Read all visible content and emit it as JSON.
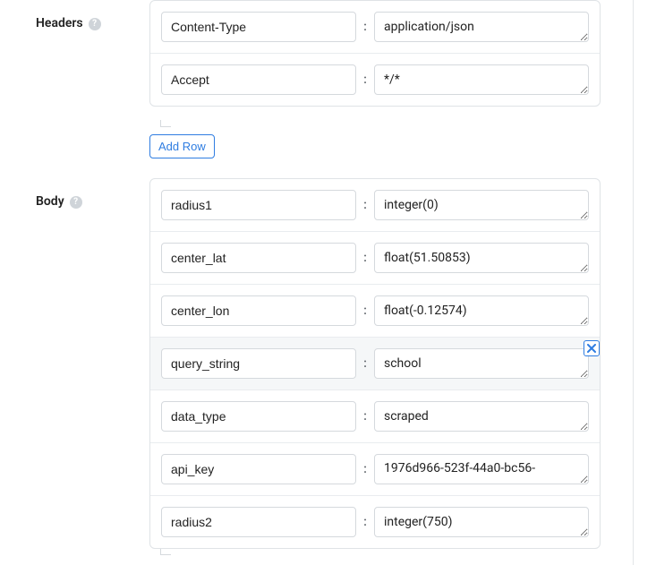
{
  "sections": {
    "headers": {
      "label": "Headers",
      "add_row_label": "Add Row",
      "rows": [
        {
          "key": "Content-Type",
          "value": "application/json"
        },
        {
          "key": "Accept",
          "value": "*/*"
        }
      ]
    },
    "body": {
      "label": "Body",
      "rows": [
        {
          "key": "radius1",
          "value": "integer(0)"
        },
        {
          "key": "center_lat",
          "value": "float(51.50853)"
        },
        {
          "key": "center_lon",
          "value": "float(-0.12574)"
        },
        {
          "key": "query_string",
          "value": "school",
          "highlighted": true,
          "deletable": true
        },
        {
          "key": "data_type",
          "value": "scraped"
        },
        {
          "key": "api_key",
          "value": "1976d966-523f-44a0-bc56-",
          "multiline": true
        },
        {
          "key": "radius2",
          "value": "integer(750)"
        }
      ]
    }
  },
  "colon": ":"
}
